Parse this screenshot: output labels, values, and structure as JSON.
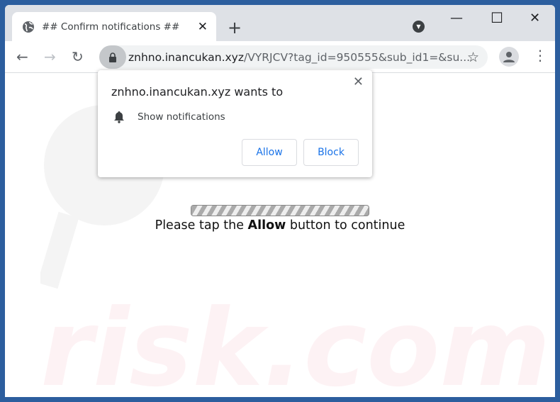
{
  "tab": {
    "title": "## Confirm notifications ##",
    "favicon": "globe-icon"
  },
  "address": {
    "domain": "znhno.inancukan.xyz",
    "path": "/VYRJCV?tag_id=950555&sub_id1=&su..."
  },
  "prompt": {
    "title": "znhno.inancukan.xyz wants to",
    "permission": "Show notifications",
    "allow": "Allow",
    "block": "Block"
  },
  "page": {
    "msg_pre": "Please tap the ",
    "msg_bold": "Allow",
    "msg_post": " button to continue"
  },
  "colors": {
    "frame": "#2c5e9e",
    "button_text": "#1a73e8"
  }
}
